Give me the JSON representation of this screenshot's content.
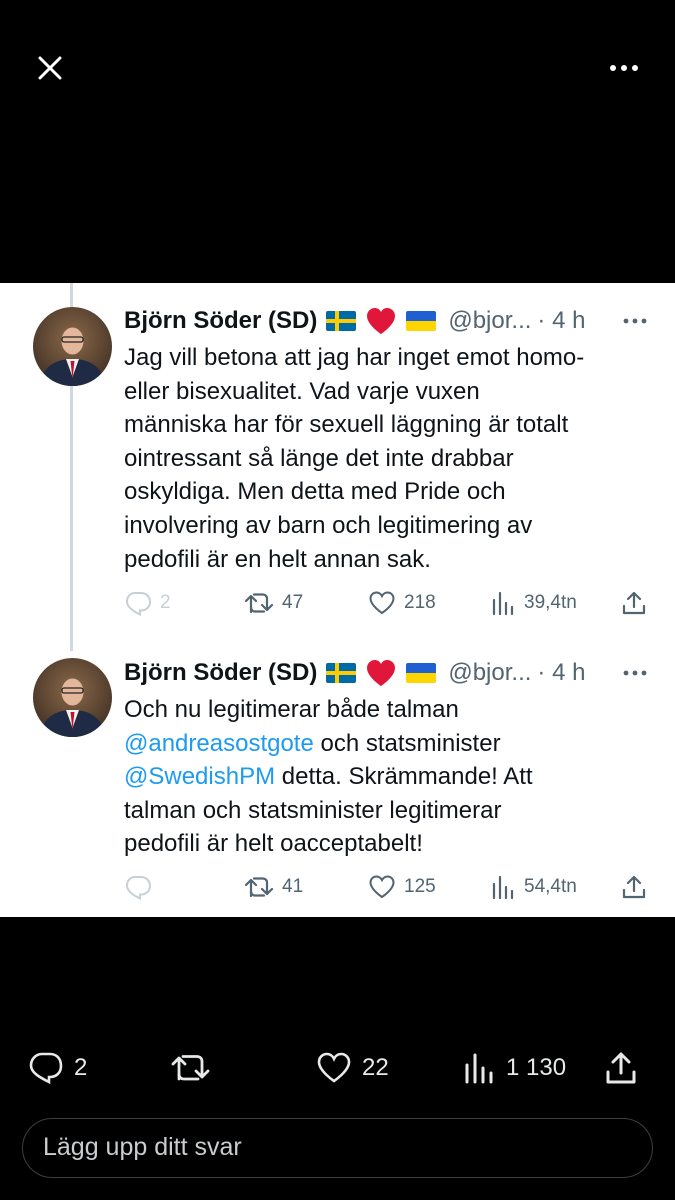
{
  "top_bar": {
    "close_icon": "close-icon",
    "more_icon": "more-horizontal-icon"
  },
  "colors": {
    "link": "#1d9bf0",
    "secondary_text": "#536471",
    "flag_sweden_blue": "#006aa7",
    "flag_sweden_yellow": "#fecc00",
    "heart": "#e0173a",
    "flag_ukraine_blue": "#1e5fd1",
    "flag_ukraine_yellow": "#ffd500"
  },
  "tweets": [
    {
      "name": "Björn Söder (SD)",
      "emojis": [
        "flag-sweden",
        "red-heart",
        "flag-ukraine"
      ],
      "handle": "@bjor...",
      "time": "· 4 h",
      "lines": [
        "Jag vill betona att jag har inget emot homo-",
        "eller bisexualitet. Vad varje vuxen",
        "människa har för sexuell läggning är totalt",
        "ointressant så länge det inte drabbar",
        "oskyldiga. Men detta med Pride och",
        "involvering av barn och legitimering av",
        "pedofili är en helt annan sak."
      ],
      "replies": "2",
      "retweets": "47",
      "likes": "218",
      "views": "39,4tn"
    },
    {
      "name": "Björn Söder (SD)",
      "emojis": [
        "flag-sweden",
        "red-heart",
        "flag-ukraine"
      ],
      "handle": "@bjor...",
      "time": "· 4 h",
      "line1": "Och nu legitimerar både talman",
      "mention1": "@andreasostgote",
      "line2_rest": " och statsminister",
      "mention2": "@SwedishPM",
      "line3_rest": " detta. Skrämmande! Att",
      "line4": "talman och statsminister legitimerar",
      "line5": "pedofili är helt oacceptabelt!",
      "replies": "",
      "retweets": "41",
      "likes": "125",
      "views": "54,4tn"
    }
  ],
  "bottom_bar": {
    "replies": "2",
    "likes": "22",
    "views": "1 130"
  },
  "reply": {
    "placeholder": "Lägg upp ditt svar"
  }
}
